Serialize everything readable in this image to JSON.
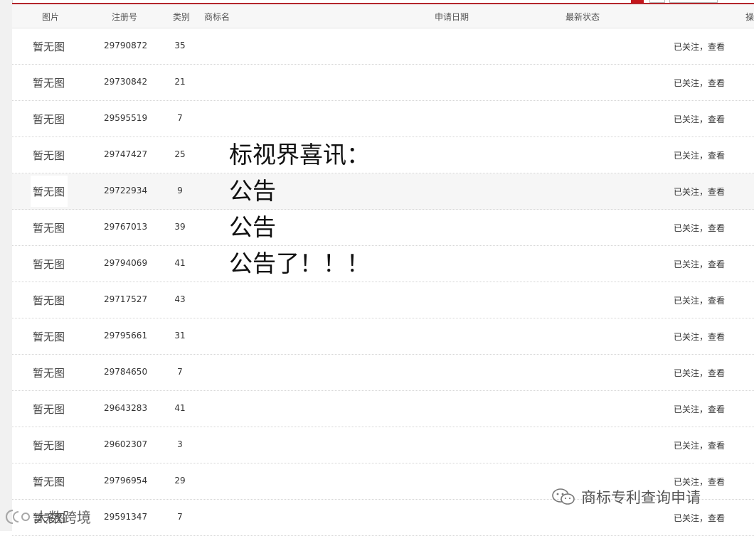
{
  "header": {
    "col_image": "图片",
    "col_reg_no": "注册号",
    "col_class": "类别",
    "col_name": "商标名",
    "col_date": "申请日期",
    "col_status": "最新状态",
    "col_op": "操"
  },
  "rows": [
    {
      "image": "暂无图",
      "reg_no": "29790872",
      "class": "35",
      "action": "已关注，查看"
    },
    {
      "image": "暂无图",
      "reg_no": "29730842",
      "class": "21",
      "action": "已关注，查看"
    },
    {
      "image": "暂无图",
      "reg_no": "29595519",
      "class": "7",
      "action": "已关注，查看"
    },
    {
      "image": "暂无图",
      "reg_no": "29747427",
      "class": "25",
      "action": "已关注，查看"
    },
    {
      "image": "暂无图",
      "reg_no": "29722934",
      "class": "9",
      "action": "已关注，查看"
    },
    {
      "image": "暂无图",
      "reg_no": "29767013",
      "class": "39",
      "action": "已关注，查看"
    },
    {
      "image": "暂无图",
      "reg_no": "29794069",
      "class": "41",
      "action": "已关注，查看"
    },
    {
      "image": "暂无图",
      "reg_no": "29717527",
      "class": "43",
      "action": "已关注，查看"
    },
    {
      "image": "暂无图",
      "reg_no": "29795661",
      "class": "31",
      "action": "已关注，查看"
    },
    {
      "image": "暂无图",
      "reg_no": "29784650",
      "class": "7",
      "action": "已关注，查看"
    },
    {
      "image": "暂无图",
      "reg_no": "29643283",
      "class": "41",
      "action": "已关注，查看"
    },
    {
      "image": "暂无图",
      "reg_no": "29602307",
      "class": "3",
      "action": "已关注，查看"
    },
    {
      "image": "暂无图",
      "reg_no": "29796954",
      "class": "29",
      "action": "已关注，查看"
    },
    {
      "image": "暂无图",
      "reg_no": "29591347",
      "class": "7",
      "action": "已关注，查看"
    }
  ],
  "notice": {
    "line1": "标视界喜讯：",
    "line2": "公告",
    "line3": "公告",
    "line4": "公告了！！！"
  },
  "watermark": {
    "right_text": "商标专利查询申请",
    "left_text": "大数跨境"
  }
}
